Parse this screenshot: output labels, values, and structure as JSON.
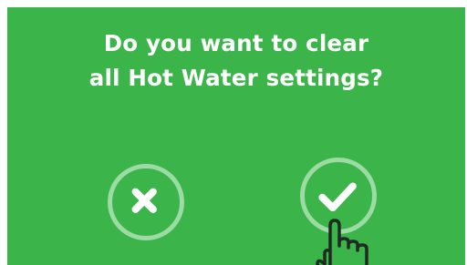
{
  "dialog": {
    "question_line1": "Do you want to clear",
    "question_line2": "all Hot Water settings?",
    "cancel_icon": "close-icon",
    "confirm_icon": "checkmark-icon",
    "cursor_icon": "hand-pointer-icon"
  },
  "colors": {
    "background": "#3bb54a",
    "text": "#ffffff",
    "ring": "#9ddba4",
    "cursor_outline": "#1f2a22"
  }
}
